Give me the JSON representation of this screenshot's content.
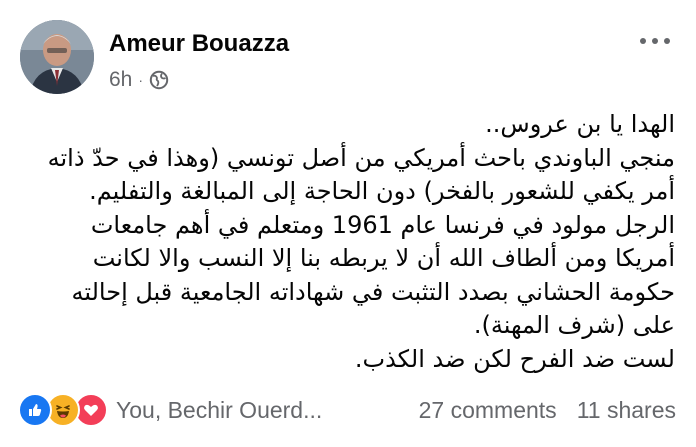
{
  "post": {
    "author": "Ameur Bouazza",
    "time": "6h",
    "separator": "·",
    "privacy_icon": "globe-icon",
    "menu_icon": "more-options-icon",
    "body_lines": [
      "الهدا يا بن عروس..",
      "منجي الباوندي باحث أمريكي من أصل تونسي (وهذا في حدّ ذاته",
      "أمر يكفي للشعور بالفخر) دون الحاجة إلى المبالغة والتفليم.",
      "الرجل مولود في فرنسا عام 1961 ومتعلم في أهم جامعات",
      "أمريكا ومن ألطاف الله أن لا يربطه بنا إلا النسب والا لكانت",
      "حكومة الحشاني بصدد التثبت في شهاداته الجامعية قبل إحالته",
      "على (شرف المهنة).",
      "لست ضد الفرح لكن ضد الكذب."
    ]
  },
  "footer": {
    "reactions": [
      "like-icon",
      "haha-icon",
      "love-icon"
    ],
    "reaction_names": "You, Bechir Ouerd...",
    "comments": "27 comments",
    "shares": "11 shares"
  },
  "colors": {
    "text": "#050505",
    "secondary": "#65676b",
    "like": "#1877f2",
    "haha": "#f7b125",
    "love": "#f33e58"
  }
}
